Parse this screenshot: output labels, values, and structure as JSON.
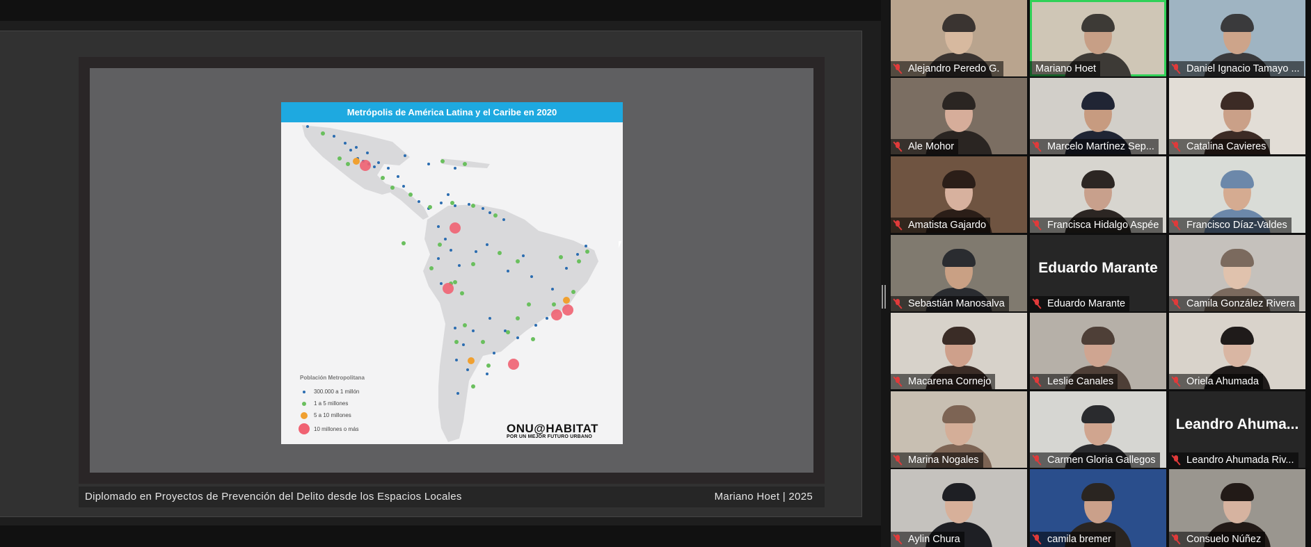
{
  "presentation": {
    "slide_title": "Metrópolis de América Latina y el Caribe en 2020",
    "legend": {
      "title": "Población Metropolitana",
      "items": [
        {
          "label": "300.000 a 1 millón",
          "color": "#2b6cb0"
        },
        {
          "label": "1 a 5 millones",
          "color": "#6abf5e"
        },
        {
          "label": "5 a 10 millones",
          "color": "#f0a030"
        },
        {
          "label": "10 millones o más",
          "color": "#f06272"
        }
      ]
    },
    "logo": {
      "main": "ONU@HABITAT",
      "sub": "POR UN MEJOR FUTURO URBANO"
    },
    "footer_left": "Diplomado en Proyectos de Prevención del Delito desde los Espacios Locales",
    "footer_right": "Mariano Hoet | 2025"
  },
  "participants": [
    {
      "name": "Alejandro Peredo G.",
      "muted": true,
      "active": false
    },
    {
      "name": "Mariano Hoet",
      "muted": false,
      "active": true
    },
    {
      "name": "Daniel Ignacio Tamayo ...",
      "muted": true,
      "active": false
    },
    {
      "name": "Ale Mohor",
      "muted": true,
      "active": false
    },
    {
      "name": "Marcelo Martínez Sep...",
      "muted": true,
      "active": false
    },
    {
      "name": "Catalina Cavieres",
      "muted": true,
      "active": false
    },
    {
      "name": "Amatista Gajardo",
      "muted": true,
      "active": false
    },
    {
      "name": "Francisca Hidalgo Aspée",
      "muted": true,
      "active": false
    },
    {
      "name": "Francisco Díaz-Valdes",
      "muted": true,
      "active": false
    },
    {
      "name": "Sebastián Manosalva",
      "muted": true,
      "active": false
    },
    {
      "name": "Eduardo Marante",
      "muted": true,
      "active": false,
      "video_off_text": "Eduardo Marante"
    },
    {
      "name": "Camila González Rivera",
      "muted": true,
      "active": false
    },
    {
      "name": "Macarena Cornejo",
      "muted": true,
      "active": false
    },
    {
      "name": "Leslie Canales",
      "muted": true,
      "active": false
    },
    {
      "name": "Oriela Ahumada",
      "muted": true,
      "active": false
    },
    {
      "name": "Marina Nogales",
      "muted": true,
      "active": false
    },
    {
      "name": "Carmen Gloria Gallegos",
      "muted": true,
      "active": false
    },
    {
      "name": "Leandro Ahumada Riv...",
      "muted": true,
      "active": false,
      "video_off_text": "Leandro  Ahuma..."
    },
    {
      "name": "Aylin Chura",
      "muted": true,
      "active": false
    },
    {
      "name": "camila bremer",
      "muted": true,
      "active": false
    },
    {
      "name": "Consuelo Núñez",
      "muted": true,
      "active": false
    }
  ]
}
